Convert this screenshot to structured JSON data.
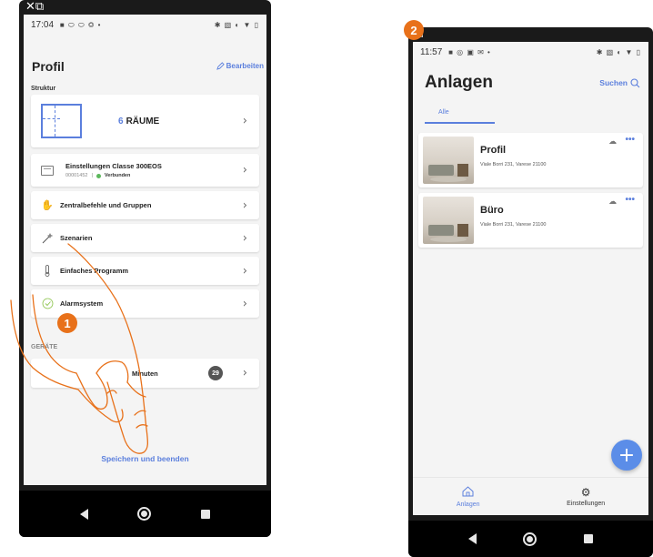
{
  "step1": {
    "badge": "1",
    "corner_icon": "✕⧉",
    "status": {
      "time": "17:04",
      "left_icons": "■ ⬭ ⬭ ◎ •",
      "right_icons": "✱ ▧ ◐ ▼ ▯"
    },
    "title": "Profil",
    "edit_label": "Bearbeiten",
    "section_structure": "Struktur",
    "rooms": {
      "count": "6",
      "label": "RÄUME"
    },
    "gateway": {
      "name": "Einstellungen Classe 300EOS",
      "id": "00001452",
      "separator": "|",
      "status": "Verbunden"
    },
    "rows": [
      {
        "label": "Zentralbefehle und Gruppen",
        "icon": "hand-icon"
      },
      {
        "label": "Szenarien",
        "icon": "magic-wand-icon"
      },
      {
        "label": "Einfaches Programm",
        "icon": "thermometer-icon"
      },
      {
        "label": "Alarmsystem",
        "icon": "shield-check-icon"
      }
    ],
    "section_devices": "GERÄTE",
    "devices_row": {
      "label": "Minuten",
      "count": "29"
    },
    "save_label": "Speichern und beenden"
  },
  "step2": {
    "badge": "2",
    "corner_icon": "⧉",
    "status": {
      "time": "11:57",
      "left_icons": "■ ◎ ▣ ✉ •",
      "right_icons": "✱ ▧ ◐ ▼ ▯"
    },
    "title": "Anlagen",
    "search_label": "Suchen",
    "tab_all": "Alle",
    "plants": [
      {
        "name": "Profil",
        "address": "Viale Borri 231, Varese 21100"
      },
      {
        "name": "Büro",
        "address": "Viale Borri 231, Varese 21100"
      }
    ],
    "more_label": "•••",
    "fab_label": "+",
    "bottom_tabs": [
      {
        "label": "Anlagen",
        "icon": "home-icon"
      },
      {
        "label": "Einstellungen",
        "icon": "gear-icon"
      }
    ]
  },
  "colors": {
    "accent": "#5b7fdd",
    "orange": "#e8711a",
    "status_green": "#5cb85c"
  }
}
